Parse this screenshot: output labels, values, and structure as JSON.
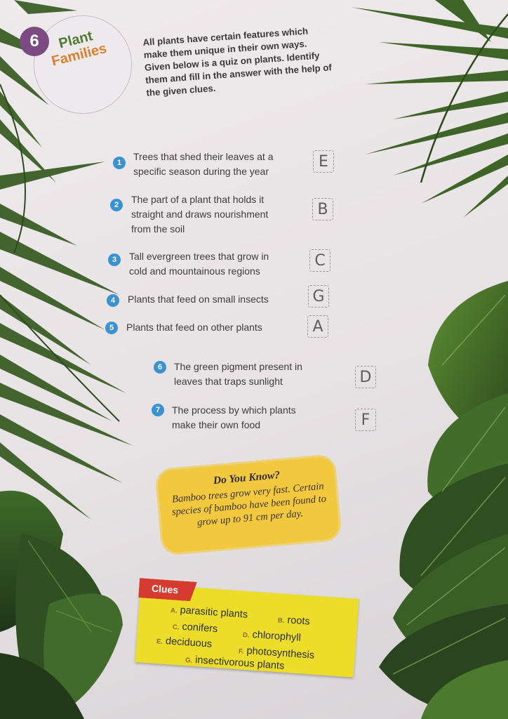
{
  "header": {
    "number": "6",
    "title_line1": "Plant",
    "title_line2": "Families"
  },
  "intro": "All plants have certain features which make them unique in their own ways. Given below is a quiz on plants. Identify them and fill in the answer with the help of the given clues.",
  "questions": [
    {
      "num": "1",
      "text": "Trees that shed their leaves at a specific season during the year",
      "answer": "E"
    },
    {
      "num": "2",
      "text": "The part of a plant that holds it straight and draws nourishment from the soil",
      "answer": "B"
    },
    {
      "num": "3",
      "text": "Tall evergreen trees that grow in cold and mountainous regions",
      "answer": "C"
    },
    {
      "num": "4",
      "text": "Plants that feed on small insects",
      "answer": "G"
    },
    {
      "num": "5",
      "text": "Plants that feed on other plants",
      "answer": "A"
    },
    {
      "num": "6",
      "text": "The green pigment present in leaves that traps sunlight",
      "answer": "D"
    },
    {
      "num": "7",
      "text": "The process by which plants make their own food",
      "answer": "F"
    }
  ],
  "do_you_know": {
    "title": "Do You Know?",
    "text": "Bamboo trees grow very fast. Certain species of bamboo have been found to grow up to 91 cm per day."
  },
  "clues": {
    "label": "Clues",
    "items": [
      {
        "letter": "A.",
        "text": "parasitic plants"
      },
      {
        "letter": "B.",
        "text": "roots"
      },
      {
        "letter": "C.",
        "text": "conifers"
      },
      {
        "letter": "D.",
        "text": "chlorophyll"
      },
      {
        "letter": "E.",
        "text": "deciduous"
      },
      {
        "letter": "F.",
        "text": "photosynthesis"
      },
      {
        "letter": "G.",
        "text": "insectivorous plants"
      }
    ]
  },
  "colors": {
    "badge": "#7b4a82",
    "title_green": "#4f7a32",
    "title_orange": "#d8822e",
    "question_number": "#3a93cf",
    "know_box": "#f2c83e",
    "clues_box": "#ecdd2a",
    "clues_tag": "#d63b2f",
    "leaf_dark": "#2f4a22",
    "leaf_mid": "#4d7a2c"
  }
}
